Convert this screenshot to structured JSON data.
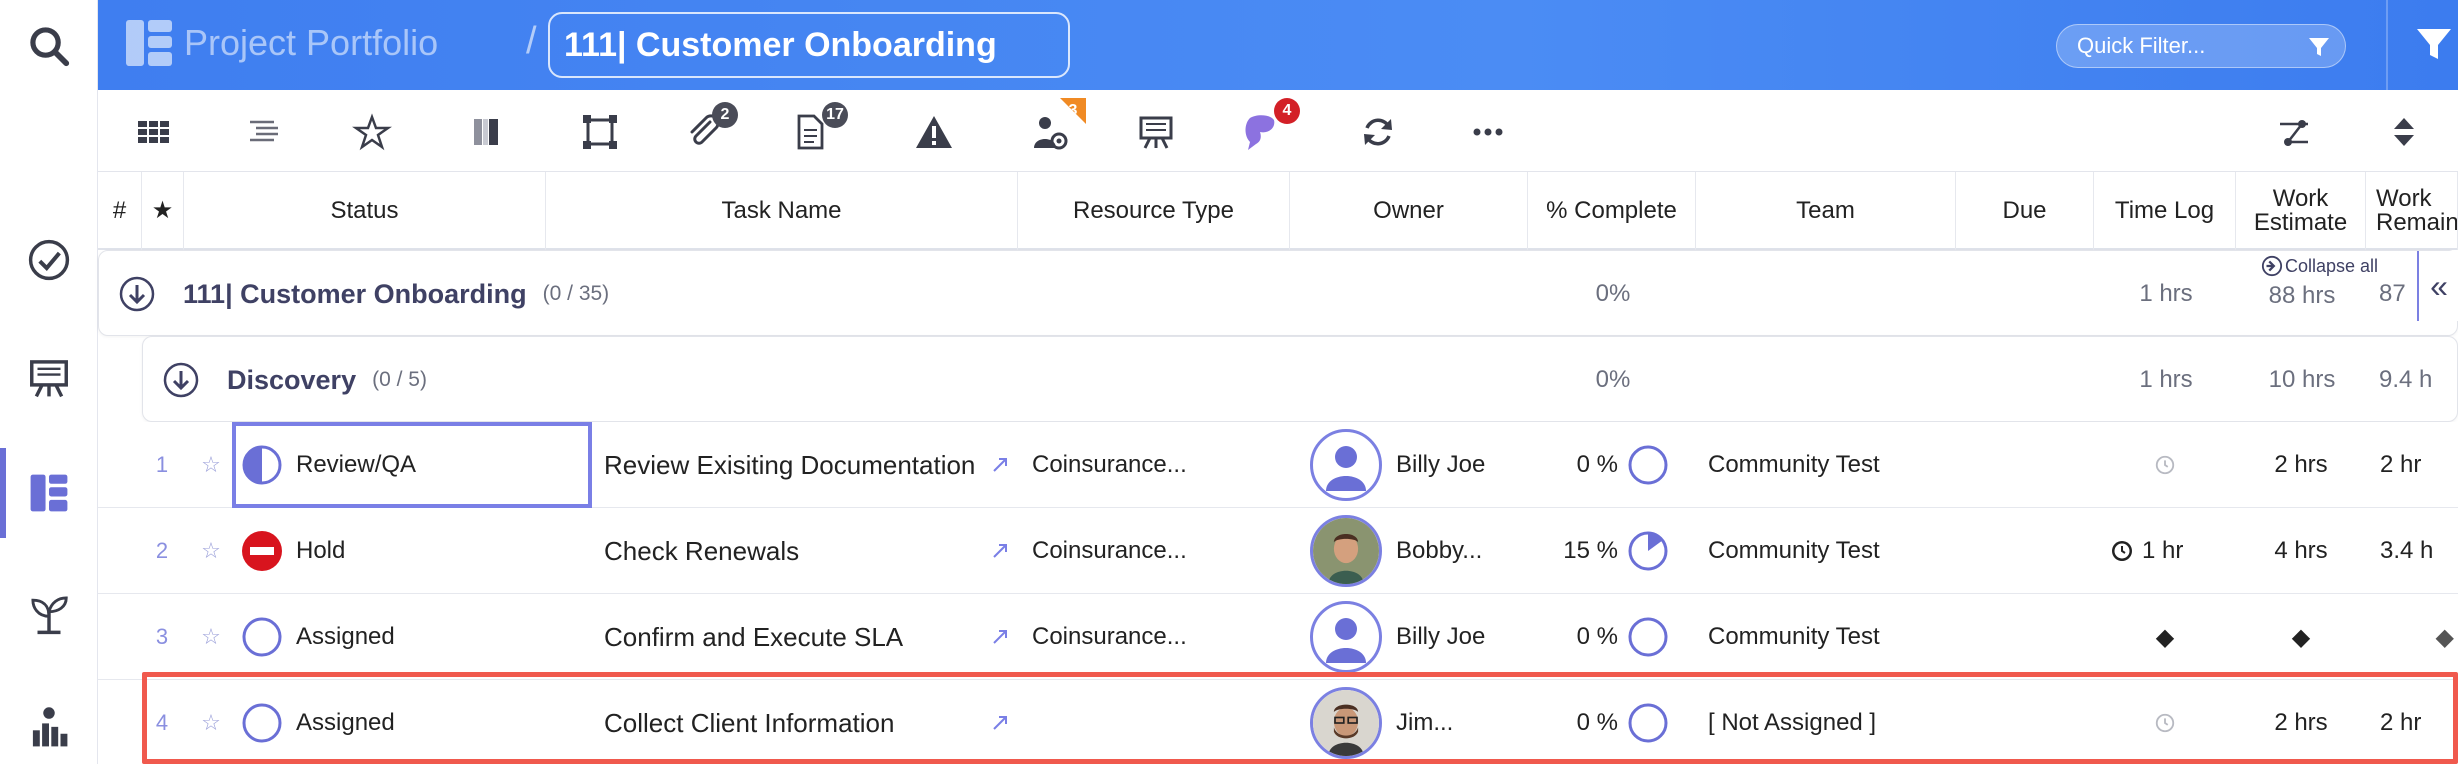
{
  "header": {
    "app_title": "Project Portfolio",
    "separator": "/",
    "project_title": "111| Customer Onboarding",
    "quick_filter_placeholder": "Quick Filter..."
  },
  "toolbar": {
    "badges": {
      "attachments": "2",
      "documents": "17",
      "resources": "3",
      "conversations": "4"
    }
  },
  "columns": {
    "num": "#",
    "star": "★",
    "status": "Status",
    "task_name": "Task Name",
    "resource_type": "Resource Type",
    "owner": "Owner",
    "pct_complete": "% Complete",
    "team": "Team",
    "due": "Due",
    "time_log": "Time Log",
    "work_estimate": "Work Estimate",
    "work_remaining": "Work Remaining"
  },
  "groups": [
    {
      "title": "111| Customer Onboarding",
      "count": "(0 / 35)",
      "pct": "0%",
      "time_log": "1 hrs",
      "work_estimate": "88 hrs",
      "work_remaining": "87",
      "collapse_all": "Collapse all",
      "collapse_btn": "«"
    },
    {
      "title": "Discovery",
      "count": "(0 / 5)",
      "pct": "0%",
      "time_log": "1 hrs",
      "work_estimate": "10 hrs",
      "work_remaining": "9.4 h"
    }
  ],
  "rows": [
    {
      "num": "1",
      "status": "Review/QA",
      "task": "Review Exisiting Documentation",
      "resource_type": "Coinsurance...",
      "owner": "Billy Joe",
      "pct": "0 %",
      "pct_value": 0,
      "team": "Community Test",
      "time_log": "",
      "work_estimate": "2 hrs",
      "work_remaining": "2 hr"
    },
    {
      "num": "2",
      "status": "Hold",
      "task": "Check Renewals",
      "resource_type": "Coinsurance...",
      "owner": "Bobby...",
      "pct": "15 %",
      "pct_value": 0.15,
      "team": "Community Test",
      "time_log": "1 hr",
      "work_estimate": "4 hrs",
      "work_remaining": "3.4 h"
    },
    {
      "num": "3",
      "status": "Assigned",
      "task": "Confirm and Execute SLA",
      "resource_type": "Coinsurance...",
      "owner": "Billy Joe",
      "pct": "0 %",
      "pct_value": 0,
      "team": "Community Test",
      "time_log": "◆",
      "work_estimate": "◆",
      "work_remaining": "◆"
    },
    {
      "num": "4",
      "status": "Assigned",
      "task": "Collect Client Information",
      "resource_type": "",
      "owner": "Jim...",
      "pct": "0 %",
      "pct_value": 0,
      "team": "[ Not Assigned ]",
      "time_log": "",
      "work_estimate": "2 hrs",
      "work_remaining": "2 hr"
    }
  ],
  "colors": {
    "header_blue": "#4285f4",
    "accent_purple": "#6a6fd6",
    "hold_red": "#d8141e",
    "highlight_red": "#f0594d",
    "badge_orange": "#f08a24",
    "badge_red": "#d32027"
  }
}
